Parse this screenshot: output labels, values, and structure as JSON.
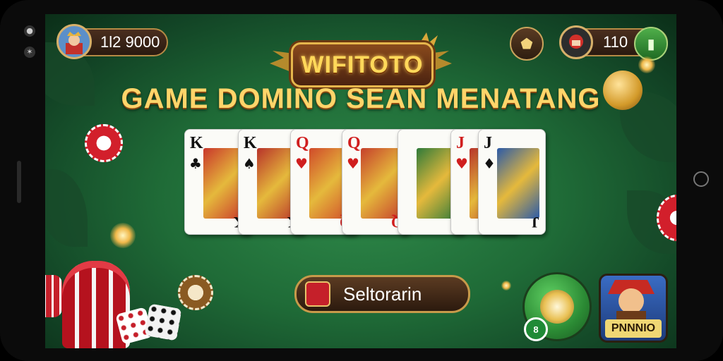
{
  "hud": {
    "balance_left": "1l2 9000",
    "balance_right": "110"
  },
  "logo": {
    "text": "WIFITOTO"
  },
  "headline": "GAME DOMINO SEAN MENATANG",
  "cards": [
    {
      "rank": "K",
      "suit": "♣",
      "color": "black"
    },
    {
      "rank": "K",
      "suit": "♠",
      "color": "black"
    },
    {
      "rank": "Q",
      "suit": "♥",
      "color": "red"
    },
    {
      "rank": "Q",
      "suit": "♥",
      "color": "red"
    },
    {
      "rank": "",
      "suit": "",
      "color": "red"
    },
    {
      "rank": "J",
      "suit": "♥",
      "color": "red"
    },
    {
      "rank": "J",
      "suit": "♦",
      "color": "black"
    }
  ],
  "actions": {
    "primary_label": "Seltorarin",
    "badge": "8",
    "hero_label": "PNNNIO"
  },
  "icons": [
    "player-avatar-icon",
    "shield-icon",
    "red-avatar-icon",
    "green-menu-icon",
    "gift-icon",
    "coin-icon"
  ]
}
